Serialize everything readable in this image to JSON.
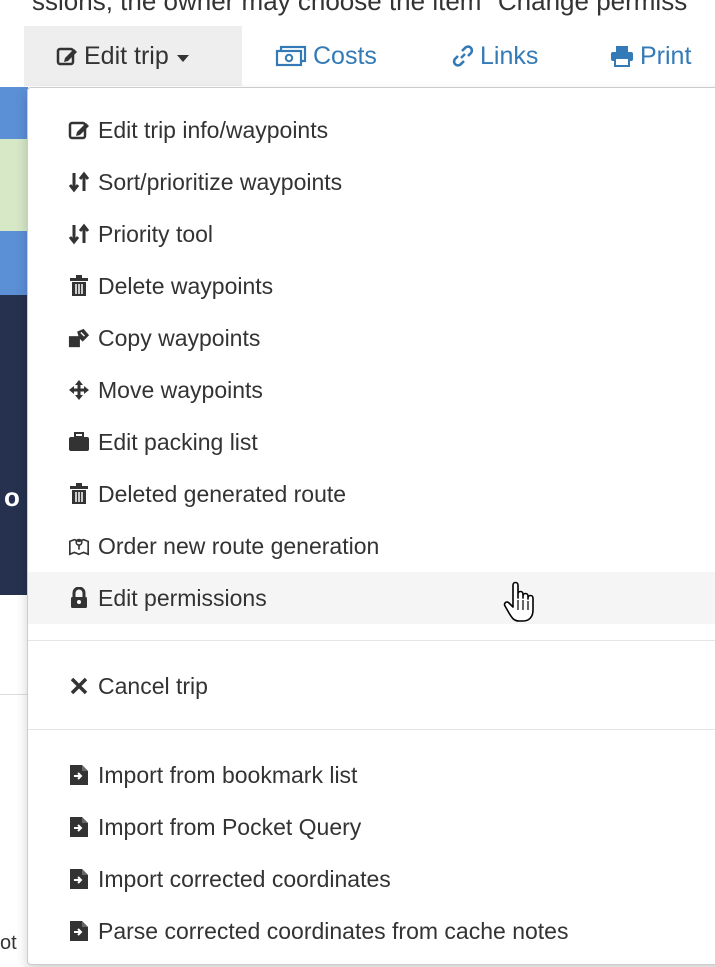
{
  "intro_text": "ssions, the owner may choose the item \"Change permiss",
  "nav": {
    "edit_trip": "Edit trip",
    "costs": "Costs",
    "links": "Links",
    "print": "Print"
  },
  "menu": {
    "items": [
      {
        "label": "Edit trip info/waypoints",
        "icon": "edit-icon"
      },
      {
        "label": "Sort/prioritize waypoints",
        "icon": "sort-icon"
      },
      {
        "label": "Priority tool",
        "icon": "sort-icon"
      },
      {
        "label": "Delete waypoints",
        "icon": "trash-icon"
      },
      {
        "label": "Copy waypoints",
        "icon": "copy-icon"
      },
      {
        "label": "Move waypoints",
        "icon": "move-icon"
      },
      {
        "label": "Edit packing list",
        "icon": "briefcase-icon"
      },
      {
        "label": "Deleted generated route",
        "icon": "trash-icon"
      },
      {
        "label": "Order new route generation",
        "icon": "map-icon"
      },
      {
        "label": "Edit permissions",
        "icon": "lock-icon"
      }
    ],
    "cancel": {
      "label": "Cancel trip",
      "icon": "close-icon"
    },
    "imports": [
      {
        "label": "Import from bookmark list",
        "icon": "file-import-icon"
      },
      {
        "label": "Import from Pocket Query",
        "icon": "file-import-icon"
      },
      {
        "label": "Import corrected coordinates",
        "icon": "file-import-icon"
      },
      {
        "label": "Parse corrected coordinates from cache notes",
        "icon": "file-import-icon"
      }
    ]
  },
  "edge_fragments": {
    "left_letter": "o",
    "left_bottom": "ot"
  },
  "colors": {
    "link": "#337ab7",
    "active_bg": "#eeeeee",
    "hover_bg": "#f5f5f5"
  }
}
